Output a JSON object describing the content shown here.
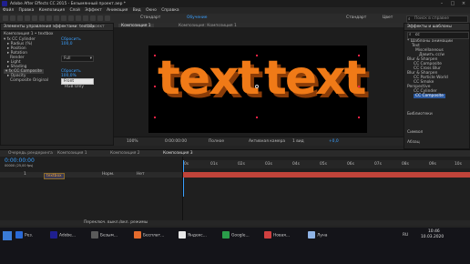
{
  "app": {
    "title": "Adobe After Effects CC 2015 - Безымянный проект.aep *",
    "accent": "#3aa0ff",
    "brand_color": "#1f1f8f"
  },
  "menubar": [
    "Файл",
    "Правка",
    "Композиция",
    "Слой",
    "Эффект",
    "Анимация",
    "Вид",
    "Окно",
    "Справка"
  ],
  "toolbar": {
    "workspace_default": "Стандарт",
    "workspace_training": "Обучение",
    "workspace_standard": "Стандарт",
    "workspace_color": "Цвет",
    "search_placeholder": "Поиск в справке"
  },
  "effects_panel": {
    "tabs": [
      "Элементы управления эффектами: textbox",
      "Проект"
    ],
    "header": "Композиция 1 • textbox",
    "rows": [
      {
        "name": "CC Cylinder",
        "value": "Сбросить",
        "value_style": "link"
      },
      {
        "name": "Radius (%)",
        "value": "100,0",
        "value_style": "link"
      },
      {
        "name": "Position",
        "value": ""
      },
      {
        "name": "Rotation",
        "value": ""
      },
      {
        "name": "Render",
        "value": "Full",
        "value_style": "select"
      },
      {
        "name": "Light",
        "value": ""
      },
      {
        "name": "Shading",
        "value": ""
      },
      {
        "name": "CC Composite",
        "value": "Сбросить",
        "value_style": "link"
      },
      {
        "name": "Opacity",
        "value": "100,0%",
        "value_style": "link"
      },
      {
        "name": "Composite Original",
        "value": "Front",
        "value_style": "select"
      },
      {
        "name": "",
        "value": "RGB Only",
        "value_style": "plain"
      }
    ]
  },
  "viewer": {
    "tabs": [
      "Композиция: Композиция 1",
      "Композиция 1"
    ],
    "text_left": "text",
    "text_right": "text",
    "controls": {
      "zoom": "100%",
      "time": "0:00:00:00",
      "quality": "Полное",
      "camera": "Активная камера",
      "views": "1 вид",
      "offset": "+0,0"
    }
  },
  "effects_presets": {
    "tab": "Эффекты и шаблоны",
    "search_value": "cc",
    "tree": [
      "* Шаблоны анимации",
      "Text",
      "Miscellaneous",
      "Давить cc/w",
      "Blur & Sharpen",
      "CC Composite",
      "CC Cross Blur",
      "Blur & Sharpen",
      "CC Particle World",
      "CC Smoke",
      "Perspective",
      "CC Cylinder",
      "CC Composite"
    ],
    "library_tab": "Библиотеки",
    "character_tab": "Символ",
    "align_tab": "Абзац",
    "paragraph_tab": "Абзац"
  },
  "timeline": {
    "tabs": [
      "Очередь рендеринга",
      "Композиция 1",
      "Композиция 2",
      "Композиция 3"
    ],
    "time": "0:00:00:00",
    "fps": "00000 (25,00 fps)",
    "layer_name": "textbox",
    "layer_num": "1",
    "mode": "Норм.",
    "parent": "Нет",
    "ruler": [
      "0s",
      "01s",
      "02s",
      "03s",
      "04s",
      "05s",
      "06s",
      "07s",
      "08s",
      "09s",
      "10s"
    ],
    "footer": "Переключ. выкл./вкл. режимы"
  },
  "taskbar": {
    "items": [
      "Рез.",
      "Adobe...",
      "Безым...",
      "Бесплат...",
      "Яндекс...",
      "Google...",
      "Новая...",
      "Луна",
      "RU"
    ],
    "time": "10:46",
    "date": "10.03.2020"
  }
}
